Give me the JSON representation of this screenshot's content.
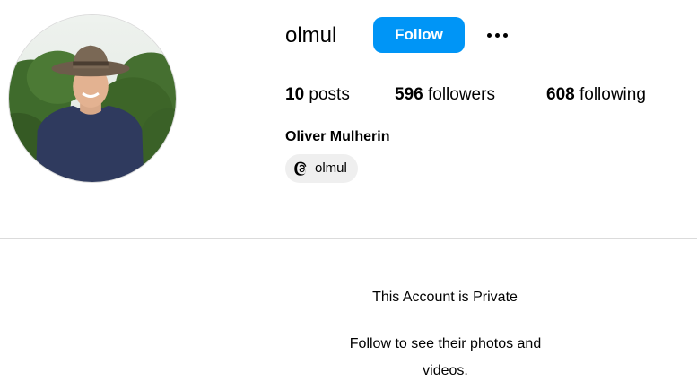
{
  "profile": {
    "username": "olmul",
    "full_name": "Oliver Mulherin",
    "follow_label": "Follow",
    "more_label": "More options",
    "avatar": "profile-photo-man-in-hat"
  },
  "stats": {
    "posts": {
      "count": "10",
      "label": "posts"
    },
    "followers": {
      "count": "596",
      "label": "followers"
    },
    "following": {
      "count": "608",
      "label": "following"
    }
  },
  "threads": {
    "handle": "olmul",
    "icon": "threads-icon"
  },
  "private": {
    "title": "This Account is Private",
    "message": "Follow to see their photos and videos."
  },
  "colors": {
    "accent": "#0095f6",
    "chip_bg": "#efefef",
    "divider": "#dbdbdb"
  }
}
